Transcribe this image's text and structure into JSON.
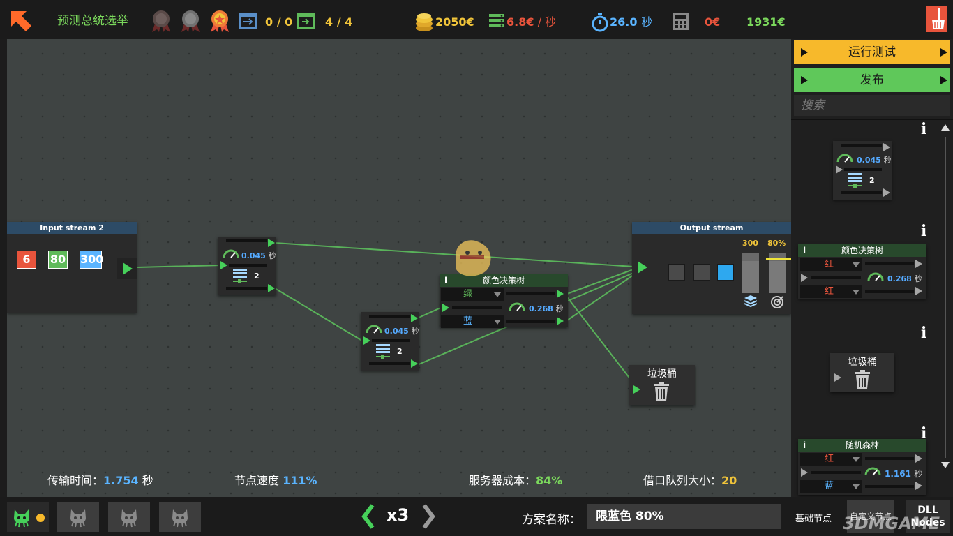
{
  "topbar": {
    "title": "预测总统选举",
    "transfer_count": "0 / 0",
    "exit_count": "4 / 4",
    "coins": "2050",
    "coin_unit": "€",
    "rate": "6.8",
    "rate_unit": "€",
    "rate_suffix": " / 秒",
    "time": "26.0",
    "time_unit": "秒",
    "cost": "0",
    "cost_unit": "€",
    "budget": "1931",
    "budget_unit": "€",
    "colors": {
      "green": "#7bd85c",
      "gold": "#f0c43a",
      "red": "#e8543c",
      "blue": "#5ab4ff",
      "orange": "#ff7a2e"
    }
  },
  "canvas": {
    "input_node": {
      "title": "Input stream 2",
      "values": [
        "6",
        "80",
        "300"
      ]
    },
    "splitter1": {
      "speed": "0.045",
      "speed_unit": "秒",
      "count": "2"
    },
    "splitter2": {
      "speed": "0.045",
      "speed_unit": "秒",
      "count": "2"
    },
    "decision": {
      "info": "i",
      "title": "颜色决策树",
      "opt1": "绿",
      "opt2": "蓝",
      "speed": "0.268",
      "speed_unit": "秒"
    },
    "output_node": {
      "title": "Output stream",
      "capacity": "300",
      "accuracy": "80%",
      "capacity_fill": 0.8,
      "accuracy_fill": 0.8
    },
    "trash": {
      "title": "垃圾桶"
    }
  },
  "stats": {
    "transfer_label": "传输时间：",
    "transfer_value": "1.754",
    "transfer_unit": "秒",
    "node_speed_label": "节点速度",
    "node_speed_value": "111%",
    "server_cost_label": "服务器成本：",
    "server_cost_value": "84%",
    "queue_label": "借口队列大小：",
    "queue_value": "20"
  },
  "rpanel": {
    "run_test": "运行测试",
    "publish": "发布",
    "search_placeholder": "搜索",
    "items": [
      {
        "info": "i",
        "speed": "0.045",
        "unit": "秒",
        "count": "2"
      },
      {
        "info": "i",
        "title": "颜色决策树",
        "opt1": "红",
        "opt2": "红",
        "speed": "0.268",
        "unit": "秒"
      },
      {
        "info": "i",
        "title": "垃圾桶"
      },
      {
        "info": "i",
        "title": "随机森林",
        "opt1": "红",
        "opt2": "蓝",
        "speed": "1.161",
        "unit": "秒"
      }
    ]
  },
  "bottombar": {
    "speed": "x3",
    "scheme_label": "方案名称：",
    "scheme_value": "限蓝色 80%",
    "tab_basic": "基础节点",
    "tab_custom": "自定义节点",
    "tab_dll_1": "DLL",
    "tab_dll_2": "Nodes",
    "watermark": "3DMGAME"
  }
}
